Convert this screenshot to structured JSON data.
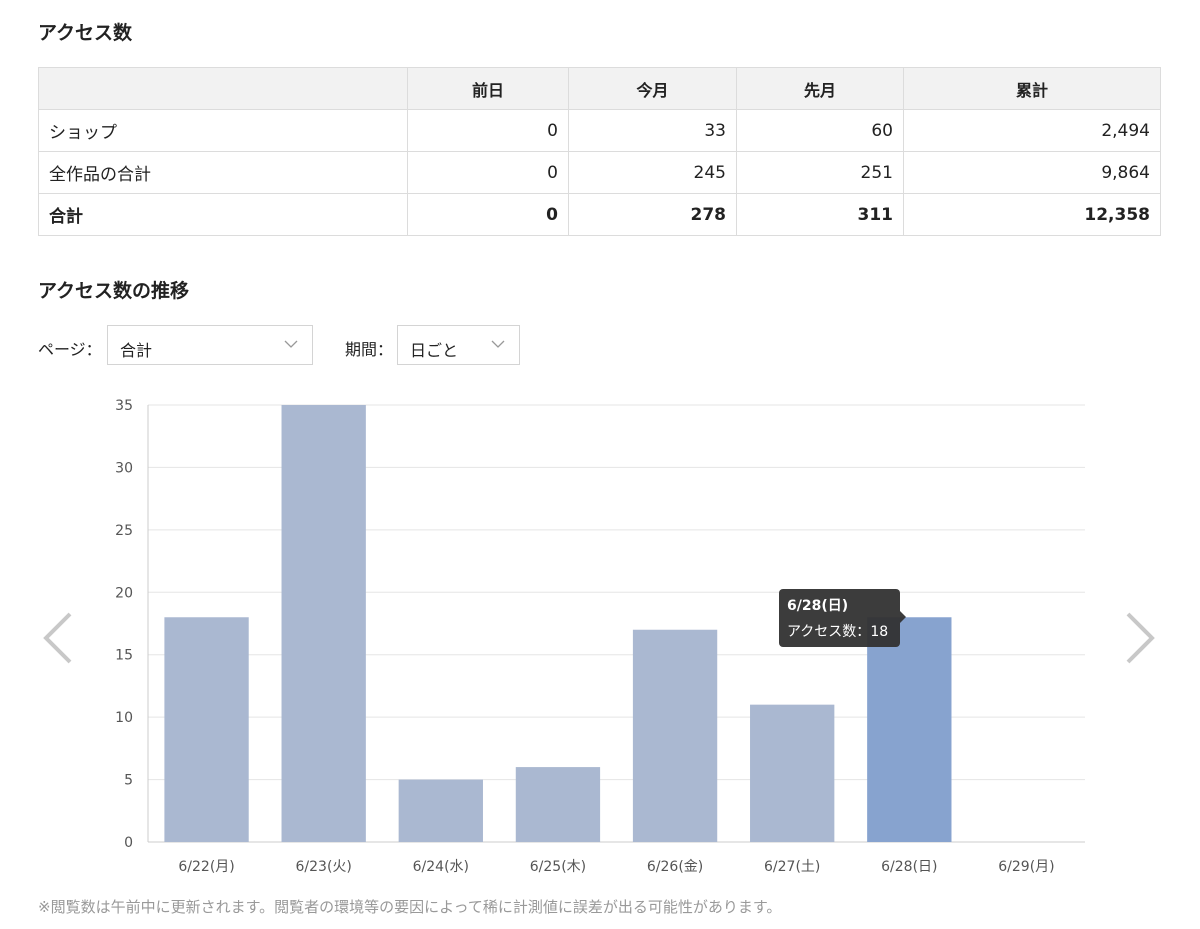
{
  "section_access": {
    "title": "アクセス数"
  },
  "table": {
    "headers": [
      "",
      "前日",
      "今月",
      "先月",
      "累計"
    ],
    "rows": [
      {
        "label": "ショップ",
        "values": [
          "0",
          "33",
          "60",
          "2,494"
        ]
      },
      {
        "label": "全作品の合計",
        "values": [
          "0",
          "245",
          "251",
          "9,864"
        ]
      }
    ],
    "total": {
      "label": "合計",
      "values": [
        "0",
        "278",
        "311",
        "12,358"
      ]
    }
  },
  "section_trend": {
    "title": "アクセス数の推移"
  },
  "filters": {
    "page_label": "ページ：",
    "page_value": "合計",
    "period_label": "期間：",
    "period_value": "日ごと"
  },
  "tooltip": {
    "title": "6/28(日)",
    "series_label": "アクセス数：",
    "value": "18"
  },
  "note": "※閲覧数は午前中に更新されます。閲覧者の環境等の要因によって稀に計測値に誤差が出る可能性があります。",
  "icons": {
    "prev": "chevron-left-icon",
    "next": "chevron-right-icon",
    "dropdown": "chevron-down-icon"
  },
  "colors": {
    "bar": "#aab8d1",
    "bar_highlight": "#87a3cf",
    "grid": "#e5e5e5",
    "axis_text": "#555555"
  },
  "chart_data": {
    "type": "bar",
    "categories": [
      "6/22(月)",
      "6/23(火)",
      "6/24(水)",
      "6/25(木)",
      "6/26(金)",
      "6/27(土)",
      "6/28(日)",
      "6/29(月)"
    ],
    "values": [
      18,
      35,
      5,
      6,
      17,
      11,
      18,
      0
    ],
    "highlighted_index": 6,
    "yticks": [
      0,
      5,
      10,
      15,
      20,
      25,
      30,
      35
    ],
    "ylim": [
      0,
      35
    ],
    "grid": true,
    "legend": "none",
    "title": "",
    "xlabel": "",
    "ylabel": ""
  }
}
